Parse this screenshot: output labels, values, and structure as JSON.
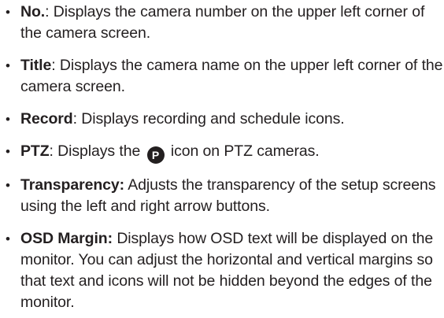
{
  "items": [
    {
      "term": "No.",
      "colon": ":",
      "text": " Displays the camera number on the upper left corner of the camera screen."
    },
    {
      "term": "Title",
      "colon": ":",
      "text": " Displays the camera name on the upper left corner of the camera screen."
    },
    {
      "term": "Record",
      "colon": ":",
      "text": " Displays recording and schedule icons."
    },
    {
      "term": "PTZ",
      "colon": ":",
      "text_before": " Displays the",
      "icon_label": "P",
      "icon": "ptz-circle-icon",
      "text_after": " icon on PTZ cameras."
    },
    {
      "term": "Transparency:",
      "text": " Adjusts the transparency of the setup screens using the left and right arrow buttons."
    },
    {
      "term": "OSD Margin:",
      "text": " Displays how OSD text will be displayed on the monitor. You can adjust the horizontal and vertical margins so that text and icons will not be hidden beyond the edges of the monitor."
    }
  ],
  "bullet_char": "•",
  "colors": {
    "text": "#231f20",
    "background": "#ffffff"
  }
}
